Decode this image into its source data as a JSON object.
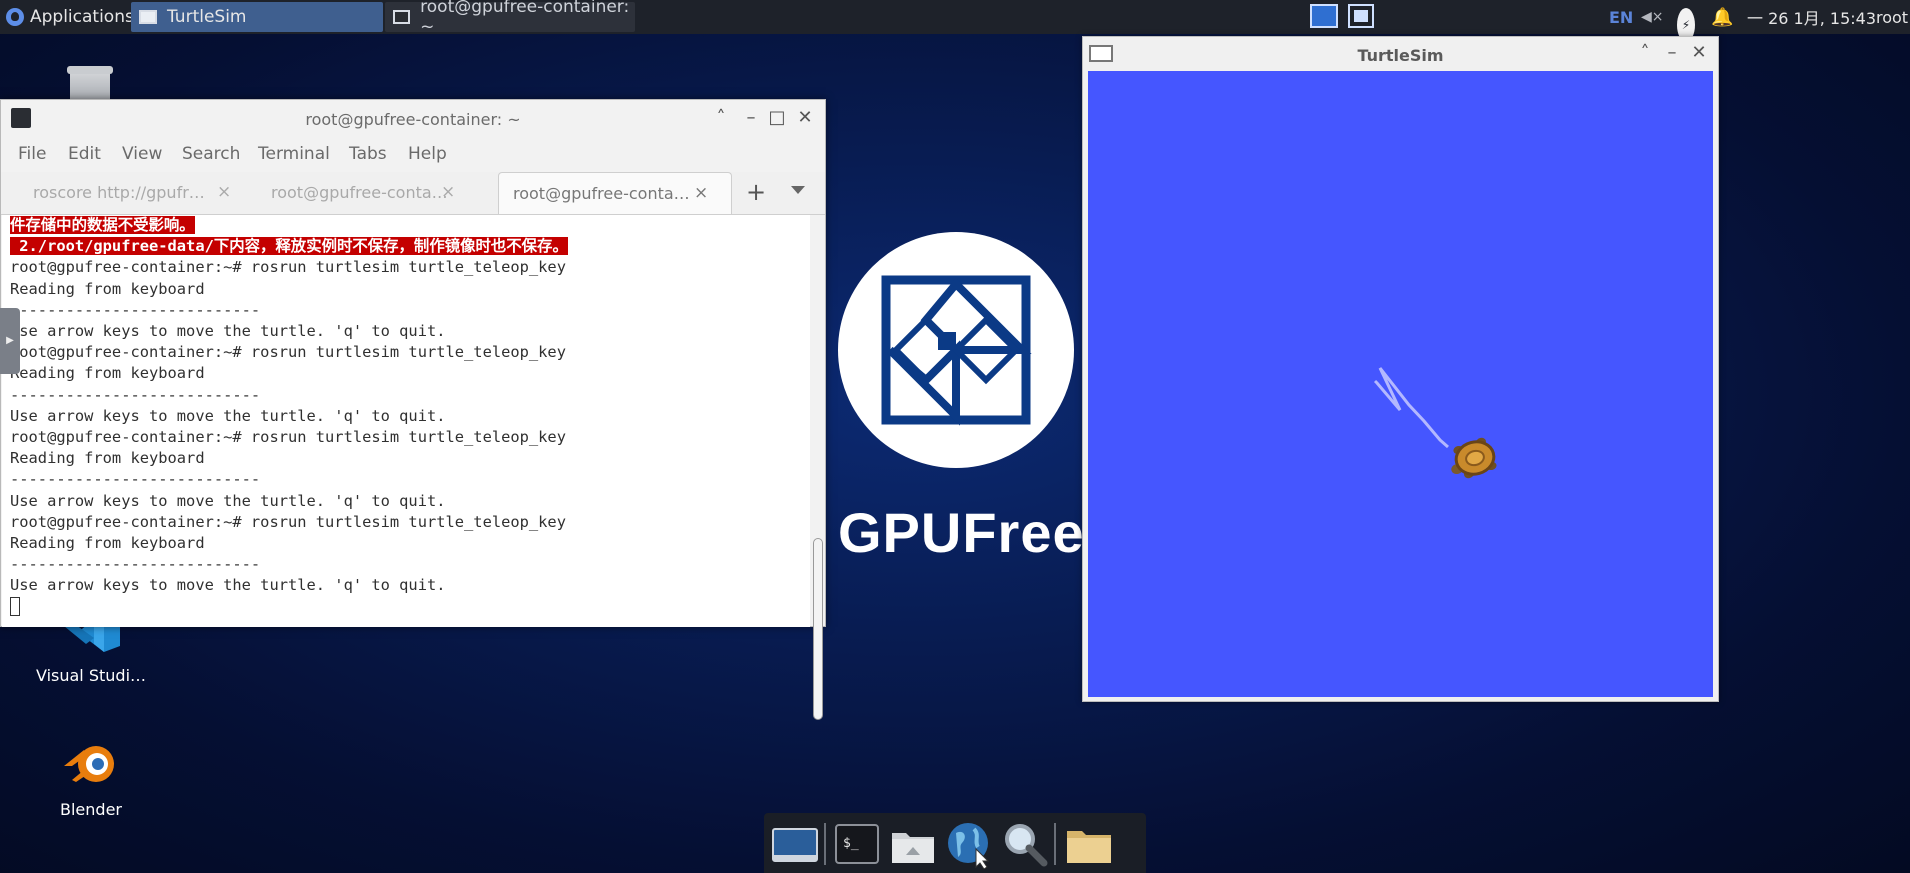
{
  "top_panel": {
    "apps_label": "Applications",
    "apps_suffix": "≡",
    "tasks": [
      {
        "label": "TurtleSim"
      },
      {
        "label": "root@gpufree-container: ~"
      }
    ],
    "lang": "EN",
    "clock": "一 26 1月, 15:43",
    "user": "root"
  },
  "desktop": {
    "icons": [
      {
        "label": "Visual Studi…"
      },
      {
        "label": "Blender"
      }
    ],
    "brand_text": "GPUFree"
  },
  "terminal": {
    "title": "root@gpufree-container: ~",
    "menu": [
      "File",
      "Edit",
      "View",
      "Search",
      "Terminal",
      "Tabs",
      "Help"
    ],
    "tabs": [
      {
        "label": "roscore http://gpufr…"
      },
      {
        "label": "root@gpufree-conta…"
      },
      {
        "label": "root@gpufree-conta…"
      }
    ],
    "lines": [
      {
        "text": "件存储中的数据不受影响。",
        "highlight": true
      },
      {
        "text": " 2./root/gpufree-data/下内容，释放实例时不保存，制作镜像时也不保存。",
        "highlight": true
      },
      {
        "text": "root@gpufree-container:~# rosrun turtlesim turtle_teleop_key"
      },
      {
        "text": "Reading from keyboard"
      },
      {
        "text": "---------------------------"
      },
      {
        "text": "Use arrow keys to move the turtle. 'q' to quit."
      },
      {
        "text": "root@gpufree-container:~# rosrun turtlesim turtle_teleop_key"
      },
      {
        "text": "Reading from keyboard"
      },
      {
        "text": "---------------------------"
      },
      {
        "text": "Use arrow keys to move the turtle. 'q' to quit."
      },
      {
        "text": "root@gpufree-container:~# rosrun turtlesim turtle_teleop_key"
      },
      {
        "text": "Reading from keyboard"
      },
      {
        "text": "---------------------------"
      },
      {
        "text": "Use arrow keys to move the turtle. 'q' to quit."
      },
      {
        "text": "root@gpufree-container:~# rosrun turtlesim turtle_teleop_key"
      },
      {
        "text": "Reading from keyboard"
      },
      {
        "text": "---------------------------"
      },
      {
        "text": "Use arrow keys to move the turtle. 'q' to quit."
      }
    ]
  },
  "turtlesim": {
    "title": "TurtleSim",
    "background_color": "#4556ff"
  },
  "dock": {
    "items": [
      "desktop-icon",
      "terminal-icon",
      "file-manager-icon",
      "web-browser-icon",
      "search-icon",
      "folder-icon"
    ]
  }
}
